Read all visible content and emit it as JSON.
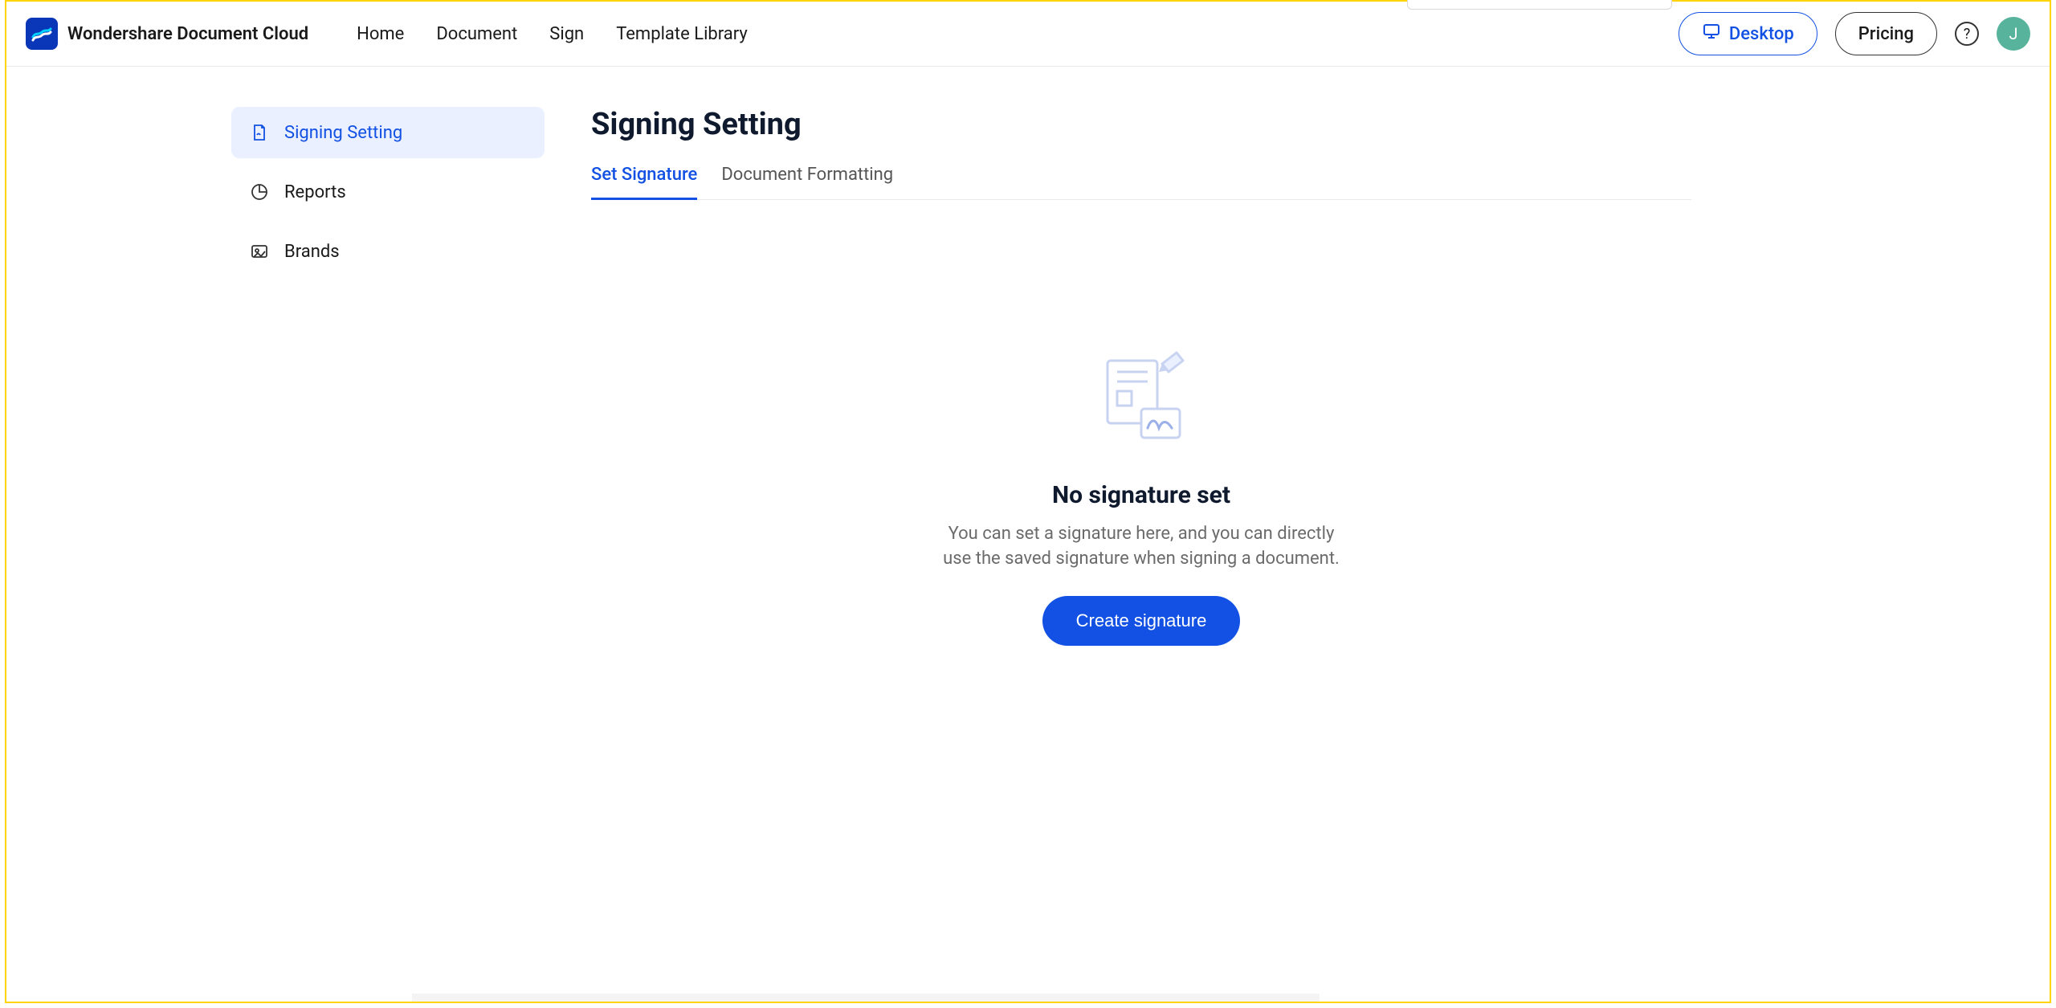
{
  "brand": {
    "name": "Wondershare Document Cloud"
  },
  "nav": {
    "items": [
      {
        "label": "Home"
      },
      {
        "label": "Document"
      },
      {
        "label": "Sign"
      },
      {
        "label": "Template Library"
      }
    ]
  },
  "header": {
    "desktop_label": "Desktop",
    "pricing_label": "Pricing",
    "avatar_initial": "J"
  },
  "sidebar": {
    "items": [
      {
        "label": "Signing Setting",
        "icon": "signature-icon",
        "active": true
      },
      {
        "label": "Reports",
        "icon": "reports-icon",
        "active": false
      },
      {
        "label": "Brands",
        "icon": "brands-icon",
        "active": false
      }
    ]
  },
  "page": {
    "title": "Signing Setting"
  },
  "tabs": {
    "items": [
      {
        "label": "Set Signature",
        "active": true
      },
      {
        "label": "Document Formatting",
        "active": false
      }
    ]
  },
  "empty": {
    "title": "No signature set",
    "description": "You can set a signature here, and you can directly use the saved signature when signing a document.",
    "cta_label": "Create signature"
  }
}
